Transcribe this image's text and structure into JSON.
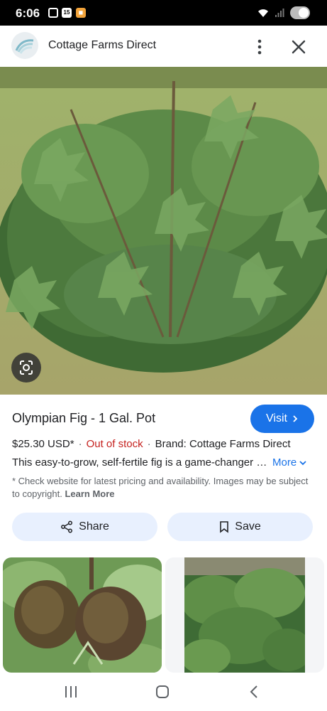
{
  "status_bar": {
    "time": "6:06",
    "calendar_badge": "15",
    "icons": [
      "screenshot-icon",
      "calendar-icon",
      "app-notification-icon",
      "wifi-icon",
      "signal-icon",
      "toggle-icon"
    ]
  },
  "header": {
    "site_name": "Cottage Farms Direct",
    "icons": [
      "site-logo",
      "more-vert-icon",
      "close-icon"
    ]
  },
  "product": {
    "title": "Olympian Fig - 1 Gal. Pot",
    "visit_label": "Visit",
    "price": "$25.30 USD*",
    "separator": "·",
    "stock": "Out of stock",
    "brand": "Brand: Cottage Farms Direct",
    "description": "This easy-to-grow, self-fertile fig is a game-changer for fig lovers",
    "more_label": "More",
    "disclaimer": "* Check website for latest pricing and availability. Images may be subject to copyright.",
    "learn_more": "Learn More"
  },
  "actions": {
    "share_label": "Share",
    "save_label": "Save"
  },
  "colors": {
    "accent": "#1a73e8",
    "stock_red": "#c5221f",
    "button_bg": "#e8f0fe"
  },
  "nav": {
    "icons": [
      "recent-apps-icon",
      "home-icon",
      "back-icon"
    ]
  }
}
